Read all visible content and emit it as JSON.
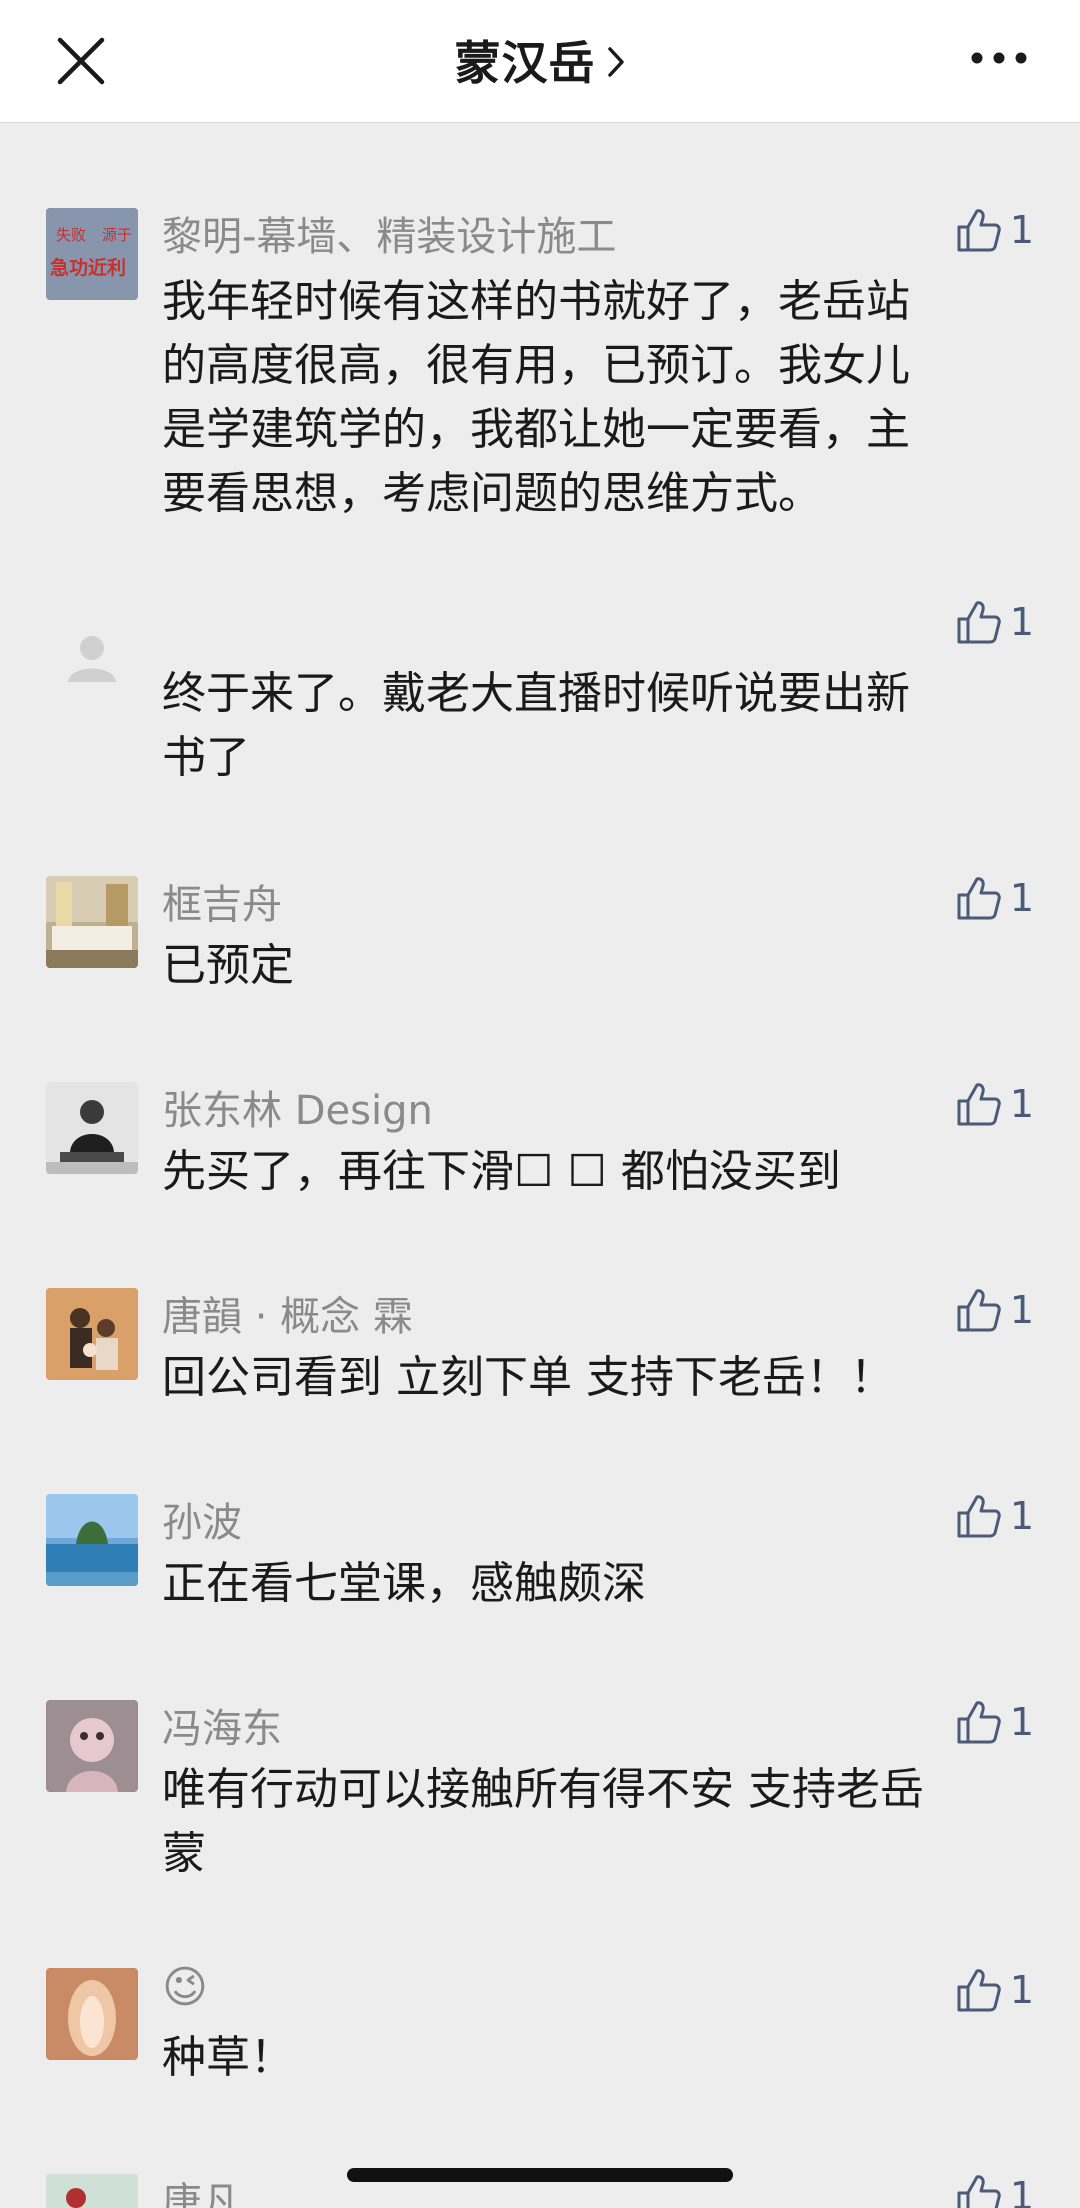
{
  "header": {
    "title": "蒙汉岳",
    "close_icon": "close-icon",
    "more_icon": "more-dots-icon"
  },
  "comments": [
    {
      "name": "黎明-幕墙、精装设计施工",
      "avatar_text_top_left": "失败",
      "avatar_text_top_right": "源于",
      "avatar_text_bottom": "急功近利",
      "lines": [
        "我年轻时候有这样的书就好了，老岳站",
        "的高度很高，很有用，已预订。我女儿",
        "是学建筑学的，我都让她一定要看，主",
        "要看思想，考虑问题的思维方式。"
      ],
      "likes": "1"
    },
    {
      "name": "",
      "lines": [
        "终于来了。戴老大直播时候听说要出新",
        "书了"
      ],
      "likes": "1"
    },
    {
      "name": "框吉舟",
      "lines": [
        "已预定"
      ],
      "likes": "1"
    },
    {
      "name": "张东林 Design",
      "lines": [
        "先买了，再往下滑☐ ☐ 都怕没买到"
      ],
      "likes": "1"
    },
    {
      "name": "唐韻 · 概念 霖",
      "lines": [
        "回公司看到  立刻下单 支持下老岳！！"
      ],
      "likes": "1"
    },
    {
      "name": "孙波",
      "lines": [
        "正在看七堂课，感触颇深"
      ],
      "likes": "1"
    },
    {
      "name": "冯海东",
      "lines": [
        "唯有行动可以接触所有得不安 支持老岳",
        "蒙"
      ],
      "likes": "1"
    },
    {
      "name": "😉",
      "lines": [
        "种草！"
      ],
      "likes": "1"
    },
    {
      "name": "唐凡",
      "lines": [],
      "likes": "1"
    }
  ],
  "colors": {
    "background": "#EDEDED",
    "header_bg": "#FFFFFF",
    "name_gray": "#8A8A8A",
    "text": "#1A1A1A",
    "like_blue": "#4A5A78"
  }
}
